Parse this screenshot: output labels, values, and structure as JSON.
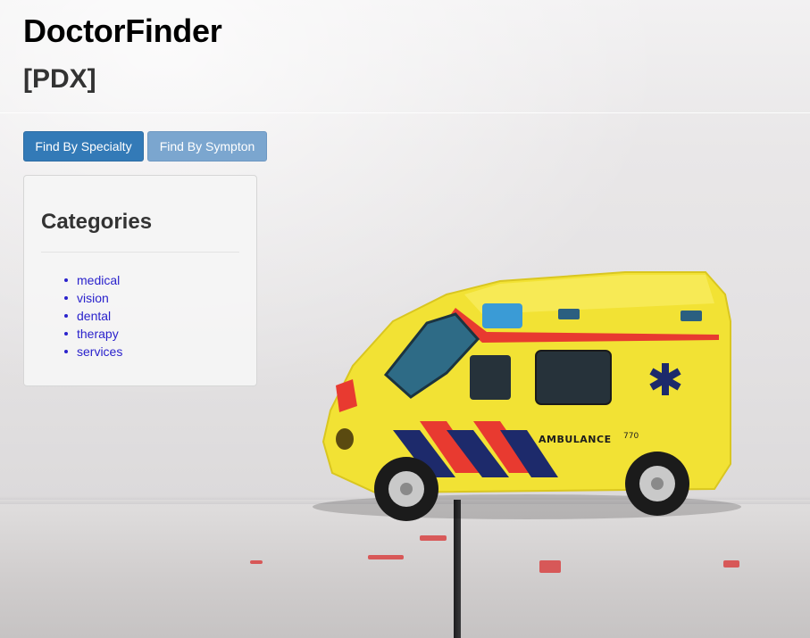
{
  "app": {
    "title": "DoctorFinder",
    "subtitle": "[PDX]"
  },
  "buttons": {
    "find_by_specialty": "Find By Specialty",
    "find_by_symptom": "Find By Sympton"
  },
  "categories_panel": {
    "heading": "Categories",
    "items": [
      {
        "label": "medical"
      },
      {
        "label": "vision"
      },
      {
        "label": "dental"
      },
      {
        "label": "therapy"
      },
      {
        "label": "services"
      }
    ]
  },
  "background": {
    "vehicle_text": "AMBULANCE",
    "vehicle_number": "770"
  },
  "colors": {
    "primary_button": "#337ab7",
    "secondary_button": "#7ba6cf",
    "link": "#2a22cc",
    "ambulance_yellow": "#f2e234"
  }
}
